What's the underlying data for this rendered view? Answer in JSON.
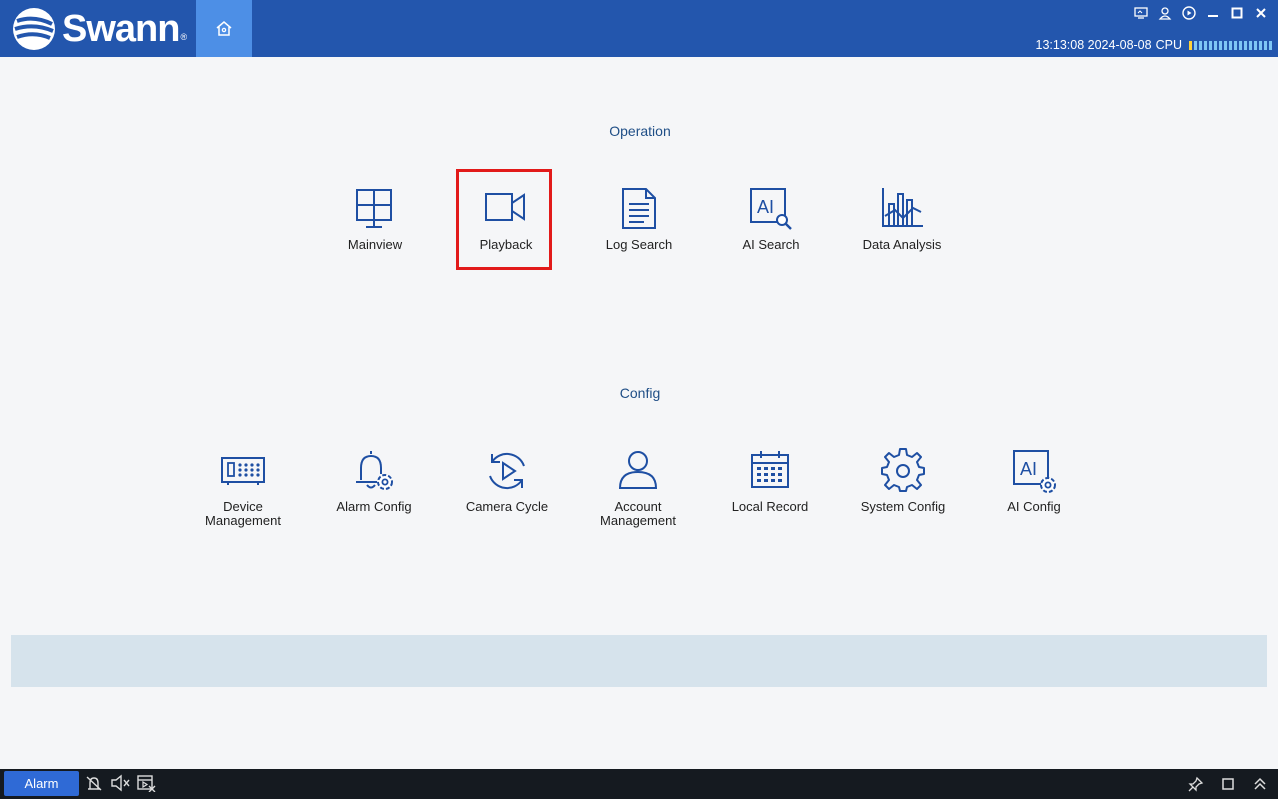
{
  "header": {
    "brand": "Swann",
    "brand_mark": "®",
    "status_time": "13:13:08 2024-08-08",
    "cpu_label": "CPU"
  },
  "window_controls": [
    "screen-icon",
    "user-icon",
    "media-icon",
    "minimize-icon",
    "maximize-icon",
    "close-icon"
  ],
  "sections": {
    "operation": {
      "title": "Operation",
      "items": [
        {
          "label": "Mainview",
          "icon": "grid-monitor-icon"
        },
        {
          "label": "Playback",
          "icon": "video-camera-icon"
        },
        {
          "label": "Log Search",
          "icon": "document-icon"
        },
        {
          "label": "AI Search",
          "icon": "ai-search-icon"
        },
        {
          "label": "Data Analysis",
          "icon": "bar-chart-icon"
        }
      ]
    },
    "config": {
      "title": "Config",
      "items": [
        {
          "label": "Device\nManagement",
          "icon": "dvr-device-icon"
        },
        {
          "label": "Alarm Config",
          "icon": "bell-gear-icon"
        },
        {
          "label": "Camera Cycle",
          "icon": "cycle-play-icon"
        },
        {
          "label": "Account\nManagement",
          "icon": "user-account-icon"
        },
        {
          "label": "Local Record",
          "icon": "calendar-icon"
        },
        {
          "label": "System Config",
          "icon": "gear-icon"
        },
        {
          "label": "AI Config",
          "icon": "ai-gear-icon"
        }
      ]
    }
  },
  "bottombar": {
    "alarm_label": "Alarm",
    "left_icons": [
      "alarm-off-icon",
      "mute-icon",
      "video-off-icon"
    ],
    "right_icons": [
      "pin-icon",
      "restore-icon",
      "collapse-up-icon"
    ]
  },
  "colors": {
    "header_bg": "#2356ad",
    "accent": "#4d8fe6",
    "icon_stroke": "#1e4fa3",
    "highlight": "#e21a1a"
  }
}
